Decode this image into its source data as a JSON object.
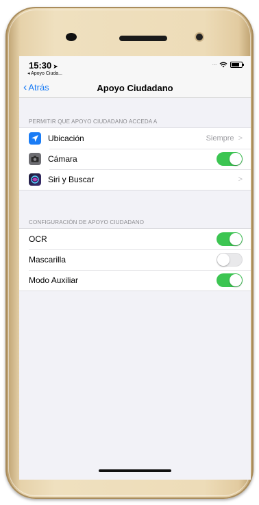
{
  "status_bar": {
    "time": "15:30",
    "back_app": "◂ Apoyo Ciuda..."
  },
  "nav": {
    "back_label": "Atrás",
    "title": "Apoyo Ciudadano"
  },
  "permissions": {
    "header": "PERMITIR QUE APOYO CIUDADANO ACCEDA A",
    "items": [
      {
        "label": "Ubicación",
        "icon": "location-arrow-icon",
        "icon_color": "#1a7cf5",
        "detail": "Siempre"
      },
      {
        "label": "Cámara",
        "icon": "camera-icon",
        "icon_color": "#6d6d72",
        "toggle": true
      },
      {
        "label": "Siri y Buscar",
        "icon": "siri-icon",
        "icon_color": "#1b1b3a"
      }
    ]
  },
  "config": {
    "header": "CONFIGURACIÓN DE APOYO CIUDADANO",
    "items": [
      {
        "label": "OCR",
        "toggle": true
      },
      {
        "label": "Mascarilla",
        "toggle": false
      },
      {
        "label": "Modo Auxiliar",
        "toggle": true
      }
    ]
  },
  "colors": {
    "accent": "#1a7cf5",
    "toggle_on": "#3cc552",
    "phone_gold": "#e6d2aa"
  }
}
